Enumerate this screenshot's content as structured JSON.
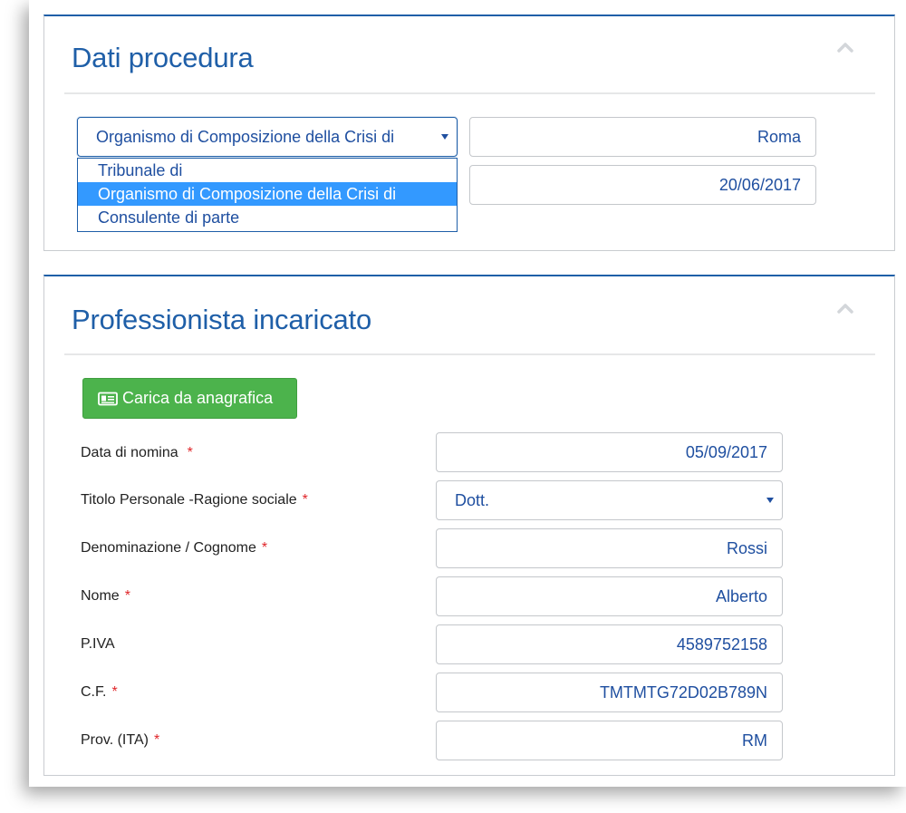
{
  "dati_procedura": {
    "title": "Dati procedura",
    "ente_select": {
      "value": "Organismo di Composizione della Crisi di",
      "options": [
        "Tribunale di",
        "Organismo di Composizione della Crisi di",
        "Consulente di parte"
      ],
      "selected_index": 1
    },
    "luogo_value": "Roma",
    "data_value": "20/06/2017"
  },
  "professionista": {
    "title": "Professionista incaricato",
    "load_button_label": "Carica da anagrafica",
    "required_marker": "*",
    "fields": {
      "data_nomina": {
        "label": "Data di nomina",
        "value": "05/09/2017"
      },
      "titolo": {
        "label": "Titolo Personale -Ragione sociale",
        "value": "Dott."
      },
      "cognome": {
        "label": "Denominazione / Cognome",
        "value": "Rossi"
      },
      "nome": {
        "label": "Nome",
        "value": "Alberto"
      },
      "piva": {
        "label": "P.IVA",
        "value": "4589752158"
      },
      "cf": {
        "label": "C.F.",
        "value": "TMTMTG72D02B789N"
      },
      "prov": {
        "label": "Prov. (ITA)",
        "value": "RM"
      }
    }
  },
  "icons": {
    "collapse": "chevron-up-icon",
    "load": "id-card-icon",
    "select": "caret-down-icon"
  },
  "colors": {
    "accent": "#1f5fa8",
    "input_text": "#1f4fa0",
    "required": "#e0262a",
    "button_green": "#4cb34c",
    "option_highlight": "#3399ff"
  }
}
